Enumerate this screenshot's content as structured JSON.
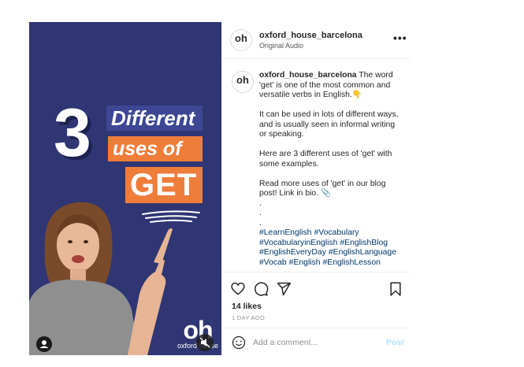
{
  "image": {
    "big_number": "3",
    "line1": "Different",
    "line2": "uses of",
    "line3": "GET",
    "logo_text": "oh",
    "logo_sub": "oxford house"
  },
  "header": {
    "username": "oxford_house_barcelona",
    "audio": "Original Audio",
    "avatar_text": "oh"
  },
  "caption": {
    "username": "oxford_house_barcelona",
    "intro": "The word 'get' is one of the most common and versatile verbs in English.",
    "emoji_1": "👇",
    "para2": "It can be used in lots of different ways, and is usually seen in informal writing or speaking.",
    "para3": "Here are 3 different uses of 'get' with some examples.",
    "para4": "Read more uses of 'get' in our blog post! Link in bio.",
    "emoji_2": "📎",
    "dots": [
      ".",
      ".",
      "."
    ],
    "hashtags": [
      "#LearnEnglish",
      "#Vocabulary",
      "#VocabularyinEnglish",
      "#EnglishBlog",
      "#EnglishEveryDay",
      "#EnglishLanguage",
      "#Vocab",
      "#English",
      "#EnglishLesson"
    ]
  },
  "actions": {
    "likes": "14 likes",
    "date": "1 DAY AGO"
  },
  "comment": {
    "placeholder": "Add a comment...",
    "post_label": "Post"
  },
  "colors": {
    "image_bg": "#2f3673",
    "orange": "#ef7d3a",
    "link_blue": "#00376b",
    "post_disabled": "#b2dffc"
  },
  "icons": [
    "user-tag-icon",
    "mute-icon",
    "more-icon",
    "heart-icon",
    "comment-icon",
    "share-icon",
    "bookmark-icon",
    "emoji-icon"
  ]
}
